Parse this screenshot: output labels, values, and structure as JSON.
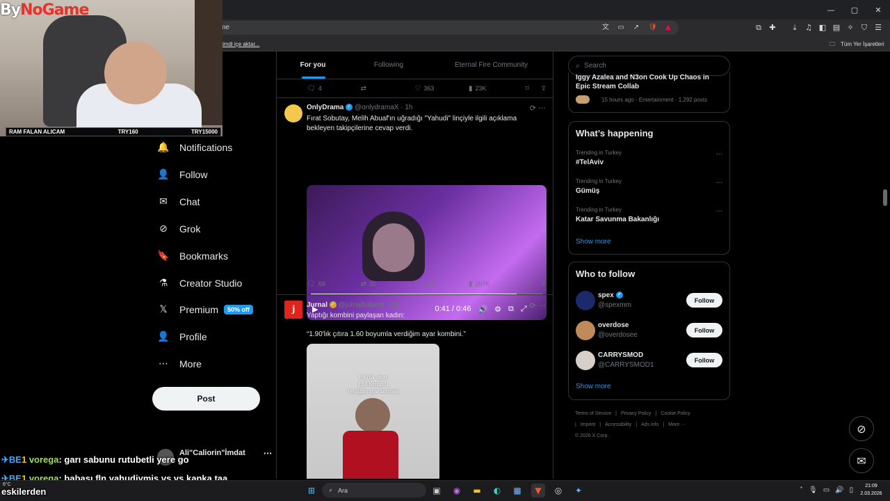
{
  "browser": {
    "url_partial": "me",
    "bookmark_import": "şimdi içe aktar...",
    "bookmarks_all": "Tüm Yer İşaretleri"
  },
  "webcam": {
    "logo_a": "By",
    "logo_b": "NoGame",
    "bar_left": "RAM FALAN ALICAM",
    "bar_mid": "TRY160",
    "bar_right": "TRY15000"
  },
  "nav": {
    "items": [
      {
        "label": "Notifications",
        "icon": "bell-icon",
        "glyph": "🔔"
      },
      {
        "label": "Follow",
        "icon": "person-add-icon",
        "glyph": "👤"
      },
      {
        "label": "Chat",
        "icon": "mail-icon",
        "glyph": "✉"
      },
      {
        "label": "Grok",
        "icon": "grok-icon",
        "glyph": "⊘"
      },
      {
        "label": "Bookmarks",
        "icon": "bookmark-icon",
        "glyph": "🔖"
      },
      {
        "label": "Creator Studio",
        "icon": "flask-icon",
        "glyph": "⚗"
      },
      {
        "label": "Premium",
        "icon": "x-logo-icon",
        "glyph": "𝕏"
      },
      {
        "label": "Profile",
        "icon": "profile-icon",
        "glyph": "👤"
      },
      {
        "label": "More",
        "icon": "more-circle-icon",
        "glyph": "⋯"
      }
    ],
    "premium_badge": "50% off",
    "post_label": "Post",
    "account_name": "Ali\"Caliorin\"İmdat"
  },
  "chat": {
    "line1_user": "vorega",
    "line1_text": "garı sabunu rutubetli yere go",
    "line2_user": "vorega",
    "line2_text": "babası fln yahudiymiş vs vs kanka taa",
    "line3_text": "eskilerden",
    "tag": "BE",
    "badge": "1"
  },
  "timeline": {
    "tabs": [
      "For you",
      "Following",
      "Eternal Fire Community"
    ],
    "prev_actions": {
      "replies": "4",
      "reposts": "",
      "likes": "363",
      "views": "23K"
    },
    "tweet1": {
      "name": "OnlyDrama",
      "handle": "@onlydramaX · 1h",
      "text": "Fırat Sobutay, Melih Abuaf'ın uğradığı \"Yahudi\" linçiyle ilgili açıklama bekleyen takipçilerine cevap verdi.",
      "video_time": "0:41 / 0:46",
      "video_progress": 0.89,
      "replies": "69",
      "reposts": "35",
      "likes": "1.5K",
      "views": "257K"
    },
    "tweet2": {
      "name": "Jurnal",
      "handle": "@jurnalhabertr · 2h",
      "text": "Yaptığı kombini paylaşan kadın:",
      "quote": "“1.90'lık çıtıra 1.60 boyumla verdiğim ayar kombini.”",
      "image_text": [
        "1,90'lık çıtıra",
        "1,60 boyumla",
        "Verdiğim ayar kombini"
      ]
    }
  },
  "sidebar": {
    "search_placeholder": "Search",
    "top_story_title_a": "Iggy Azalea and N3on Cook Up Chaos in",
    "top_story_title_b": "Epic Stream Collab",
    "top_story_meta": "15 hours ago · Entertainment · 1,292 posts",
    "happening_title": "What’s happening",
    "trends": [
      {
        "meta": "Trending in Turkey",
        "name": "#TelAviv"
      },
      {
        "meta": "Trending in Turkey",
        "name": "Gümüş"
      },
      {
        "meta": "Trending in Turkey",
        "name": "Katar Savunma Bakanlığı"
      }
    ],
    "show_more": "Show more",
    "wtf_title": "Who to follow",
    "wtf": [
      {
        "name": "spex",
        "handle": "@spexmm",
        "verified": true,
        "avatar_color": "#1a2a6a"
      },
      {
        "name": "overdose",
        "handle": "@overdosee",
        "verified": false,
        "avatar_color": "#c08a5a"
      },
      {
        "name": "CARRYSMOD",
        "handle": "@CARRYSMOD1",
        "verified": false,
        "avatar_color": "#d8d0c8"
      }
    ],
    "follow_label": "Follow",
    "footer": [
      "Terms of Service",
      "|",
      "Privacy Policy",
      "|",
      "Cookie Policy",
      "|",
      "Imprint",
      "|",
      "Accessibility",
      "|",
      "Ads info",
      "|",
      "More ···",
      "© 2026 X Corp."
    ]
  },
  "taskbar": {
    "search": "Ara",
    "time": "21:09",
    "date": "2.03.2026",
    "weather": "6°C"
  }
}
